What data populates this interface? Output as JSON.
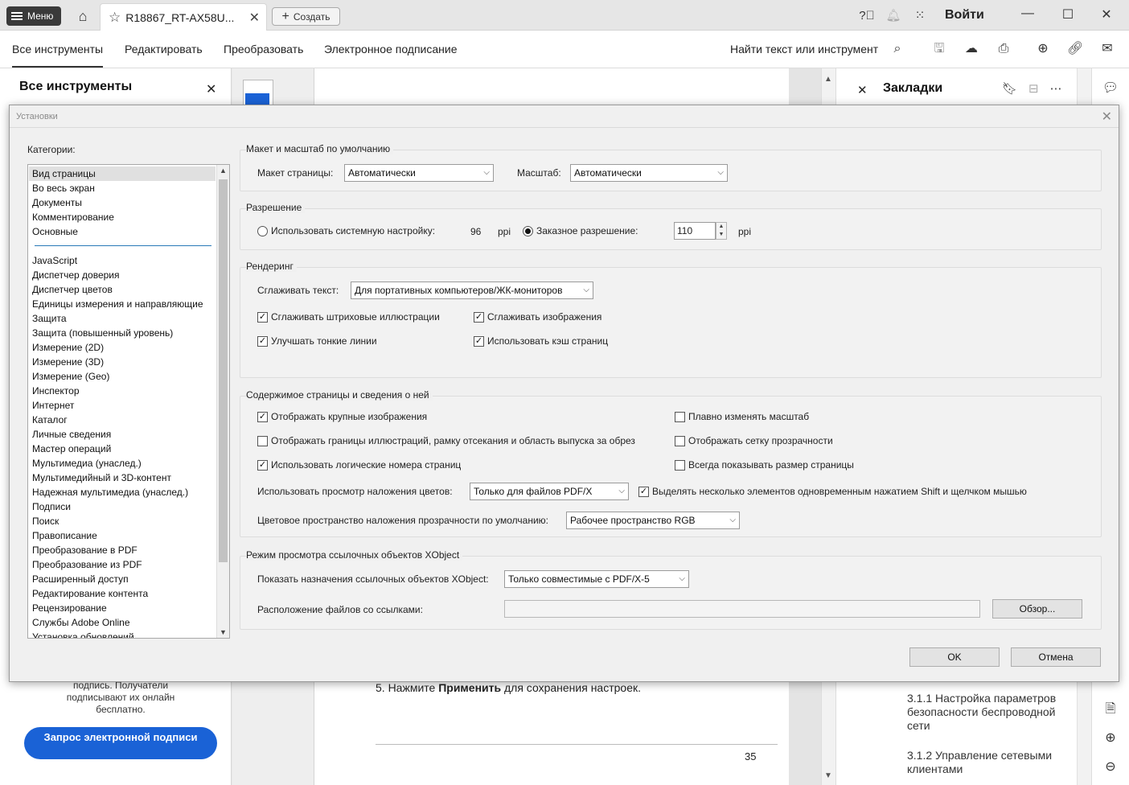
{
  "titlebar": {
    "menu_label": "Меню",
    "doc_tab_title": "R18867_RT-AX58U...",
    "create_label": "Создать",
    "signin_label": "Войти"
  },
  "toolbar": {
    "tabs": [
      "Все инструменты",
      "Редактировать",
      "Преобразовать",
      "Электронное подписание"
    ],
    "find_label": "Найти текст или инструмент"
  },
  "left_panel": {
    "title": "Все инструменты",
    "text": "подпись. Получатели подписывают их онлайн бесплатно.",
    "button_label": "Запрос электронной подписи"
  },
  "document": {
    "step_prefix": "5.  Нажмите ",
    "step_bold": "Применить",
    "step_suffix": " для сохранения настроек.",
    "page_number": "35"
  },
  "bookmarks": {
    "title": "Закладки",
    "items": [
      "3.1.1 Настройка параметров безопасности беспроводной сети",
      "3.1.2 Управление сетевыми клиентами"
    ]
  },
  "dialog": {
    "title": "Установки",
    "categories_label": "Категории:",
    "categories_top": [
      "Вид страницы",
      "Во весь экран",
      "Документы",
      "Комментирование",
      "Основные"
    ],
    "categories": [
      "JavaScript",
      "Диспетчер доверия",
      "Диспетчер цветов",
      "Единицы измерения и направляющие",
      "Защита",
      "Защита (повышенный уровень)",
      "Измерение (2D)",
      "Измерение (3D)",
      "Измерение (Geo)",
      "Инспектор",
      "Интернет",
      "Каталог",
      "Личные сведения",
      "Мастер операций",
      "Мультимедиа (унаслед.)",
      "Мультимедийный и 3D-контент",
      "Надежная мультимедиа (унаслед.)",
      "Подписи",
      "Поиск",
      "Правописание",
      "Преобразование в PDF",
      "Преобразование из PDF",
      "Расширенный доступ",
      "Редактирование контента",
      "Рецензирование",
      "Службы Adobe Online",
      "Установка обновлений"
    ],
    "layout": {
      "group_title": "Макет и масштаб по умолчанию",
      "page_layout_label": "Макет страницы:",
      "page_layout_value": "Автоматически",
      "zoom_label": "Масштаб:",
      "zoom_value": "Автоматически"
    },
    "resolution": {
      "group_title": "Разрешение",
      "system_label": "Использовать системную настройку:",
      "system_value": "96",
      "system_unit": "ppi",
      "custom_label": "Заказное разрешение:",
      "custom_value": "110",
      "custom_unit": "ppi"
    },
    "rendering": {
      "group_title": "Рендеринг",
      "smooth_text_label": "Сглаживать текст:",
      "smooth_text_value": "Для портативных компьютеров/ЖК-мониторов",
      "smooth_line_art": "Сглаживать штриховые иллюстрации",
      "smooth_images": "Сглаживать изображения",
      "enhance_thin_lines": "Улучшать тонкие линии",
      "page_cache": "Использовать кэш страниц"
    },
    "page_content": {
      "group_title": "Содержимое страницы и сведения о ней",
      "large_images": "Отображать крупные изображения",
      "smooth_zoom": "Плавно изменять масштаб",
      "art_boxes": "Отображать границы иллюстраций, рамку отсекания и область выпуска за обрез",
      "transparency_grid": "Отображать сетку прозрачности",
      "logical_pages": "Использовать логические номера страниц",
      "always_page_size": "Всегда показывать размер страницы",
      "overprint_label": "Использовать просмотр наложения цветов:",
      "overprint_value": "Только для файлов PDF/X",
      "shift_select": "Выделять несколько элементов одновременным нажатием Shift и щелчком мышью",
      "blend_label": "Цветовое пространство наложения прозрачности по умолчанию:",
      "blend_value": "Рабочее пространство RGB"
    },
    "xobject": {
      "group_title": "Режим просмотра ссылочных объектов XObject",
      "show_label": "Показать назначения ссылочных объектов XObject:",
      "show_value": "Только совместимые с PDF/X-5",
      "location_label": "Расположение файлов со ссылками:",
      "location_value": "",
      "browse_label": "Обзор..."
    },
    "ok_label": "OK",
    "cancel_label": "Отмена"
  }
}
